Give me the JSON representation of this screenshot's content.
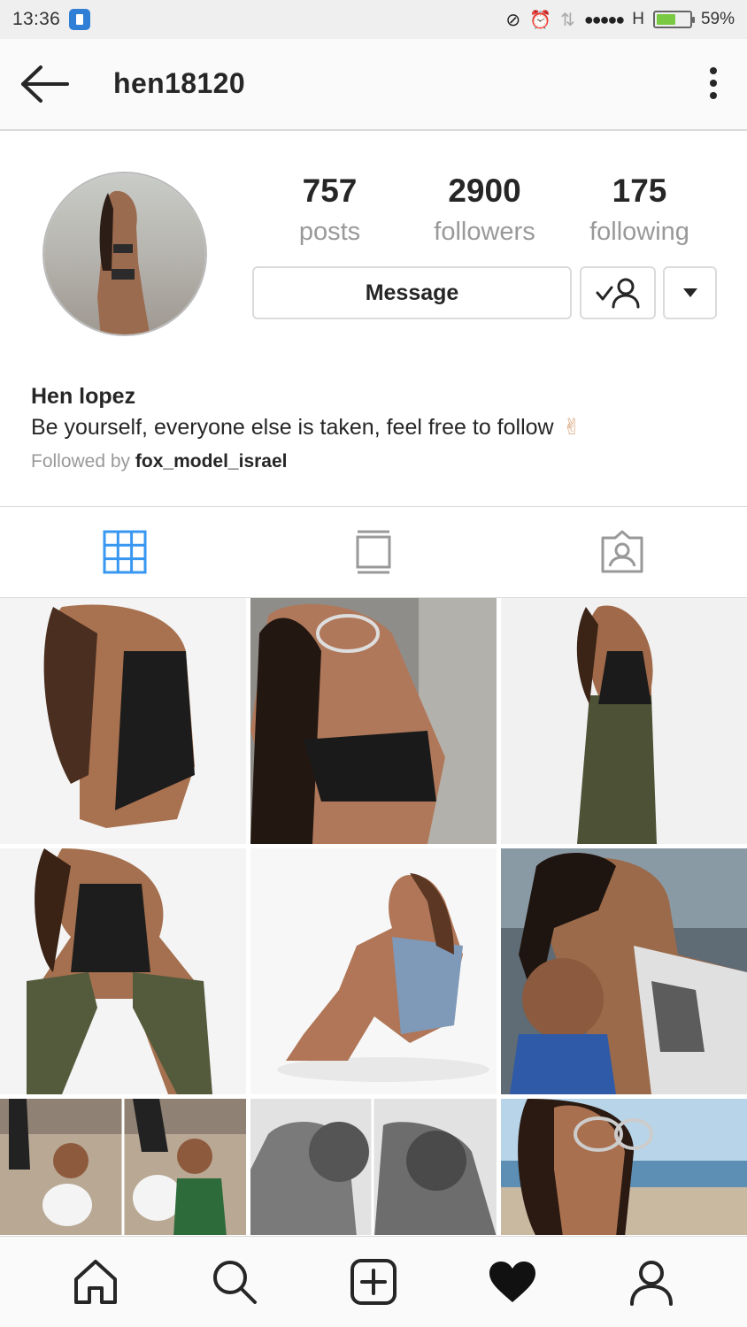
{
  "status_bar": {
    "time": "13:36",
    "network": "H",
    "battery_percent": "59%",
    "battery_level": 0.59
  },
  "header": {
    "username": "hen18120"
  },
  "profile": {
    "stats": [
      {
        "value": "757",
        "label": "posts"
      },
      {
        "value": "2900",
        "label": "followers"
      },
      {
        "value": "175",
        "label": "following"
      }
    ],
    "message_label": "Message",
    "name": "Hen lopez",
    "bio": "Be yourself, everyone else is taken, feel free to follow",
    "bio_emoji": "✌",
    "followed_by_prefix": "Followed by",
    "followed_by_user": "fox_model_israel"
  },
  "tabs": [
    {
      "icon": "grid-icon",
      "active": true
    },
    {
      "icon": "feed-icon",
      "active": false
    },
    {
      "icon": "tagged-icon",
      "active": false
    }
  ],
  "grid_photos": 9,
  "bottom_nav": [
    {
      "icon": "home-icon"
    },
    {
      "icon": "search-icon"
    },
    {
      "icon": "add-post-icon"
    },
    {
      "icon": "heart-icon"
    },
    {
      "icon": "profile-icon"
    }
  ],
  "colors": {
    "accent": "#3897f0",
    "text": "#262626",
    "muted": "#999999",
    "border": "#dbdbdb"
  }
}
